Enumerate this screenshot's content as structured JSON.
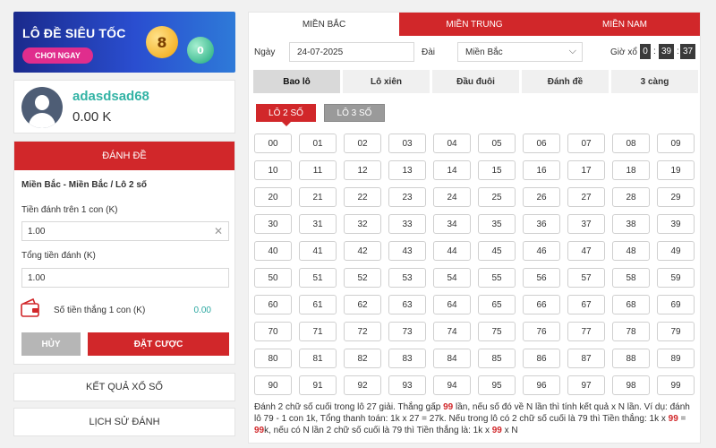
{
  "banner": {
    "title": "LÔ ĐỀ SIÊU TỐC",
    "button_label": "CHƠI NGAY",
    "ball1": "8",
    "ball2": "0"
  },
  "profile": {
    "username": "adasdsad68",
    "balance": "0.00 K"
  },
  "bet_form": {
    "header": "ĐÁNH ĐỀ",
    "breadcrumb": "Miền Bắc - Miền Bắc / Lô 2 số",
    "per_unit_label": "Tiền đánh trên 1 con (K)",
    "per_unit_value": "1.00",
    "total_label": "Tổng tiền đánh (K)",
    "total_value": "1.00",
    "win_label": "Số tiền thắng 1 con (K)",
    "win_value": "0.00",
    "cancel_label": "HỦY",
    "place_bet_label": "ĐẶT CƯỢC"
  },
  "side_nav": {
    "results": "KẾT QUẢ XỔ SỐ",
    "history": "LỊCH SỬ ĐÁNH"
  },
  "region_tabs": [
    "MIỀN BẮC",
    "MIỀN TRUNG",
    "MIỀN NAM"
  ],
  "filters": {
    "date_label": "Ngày",
    "date_value": "24-07-2025",
    "station_label": "Đài",
    "station_value": "Miền Bắc",
    "time_label": "Giờ xổ",
    "time_h": "0",
    "time_m": "39",
    "time_s": "37"
  },
  "type_tabs": [
    "Bao lô",
    "Lô xiên",
    "Đầu đuôi",
    "Đánh đề",
    "3 càng"
  ],
  "sub_tabs": [
    "LÔ 2 SỐ",
    "LÔ 3 SỐ"
  ],
  "numbers": [
    "00",
    "01",
    "02",
    "03",
    "04",
    "05",
    "06",
    "07",
    "08",
    "09",
    "10",
    "11",
    "12",
    "13",
    "14",
    "15",
    "16",
    "17",
    "18",
    "19",
    "20",
    "21",
    "22",
    "23",
    "24",
    "25",
    "26",
    "27",
    "28",
    "29",
    "30",
    "31",
    "32",
    "33",
    "34",
    "35",
    "36",
    "37",
    "38",
    "39",
    "40",
    "41",
    "42",
    "43",
    "44",
    "45",
    "46",
    "47",
    "48",
    "49",
    "50",
    "51",
    "52",
    "53",
    "54",
    "55",
    "56",
    "57",
    "58",
    "59",
    "60",
    "61",
    "62",
    "63",
    "64",
    "65",
    "66",
    "67",
    "68",
    "69",
    "70",
    "71",
    "72",
    "73",
    "74",
    "75",
    "76",
    "77",
    "78",
    "79",
    "80",
    "81",
    "82",
    "83",
    "84",
    "85",
    "86",
    "87",
    "88",
    "89",
    "90",
    "91",
    "92",
    "93",
    "94",
    "95",
    "96",
    "97",
    "98",
    "99"
  ],
  "description": {
    "p1": "Đánh 2 chữ số cuối trong lô 27 giải. Thắng gấp ",
    "h1": "99",
    "p2": " lần, nếu số đó về N lần thì tính kết quả x N lần. Ví dụ: đánh lô 79 - 1 con 1k, Tổng thanh toán: 1k x 27 = 27k. Nếu trong lô có 2 chữ số cuối là 79 thì Tiền thắng: 1k x ",
    "h2": "99",
    "p3": " = ",
    "h3": "99",
    "p4": "k, nếu có N lần 2 chữ số cuối là 79 thì Tiền thắng là: 1k x ",
    "h4": "99",
    "p5": " x N"
  },
  "colors": {
    "accent_red": "#d1272a",
    "teal": "#33b3a5"
  }
}
